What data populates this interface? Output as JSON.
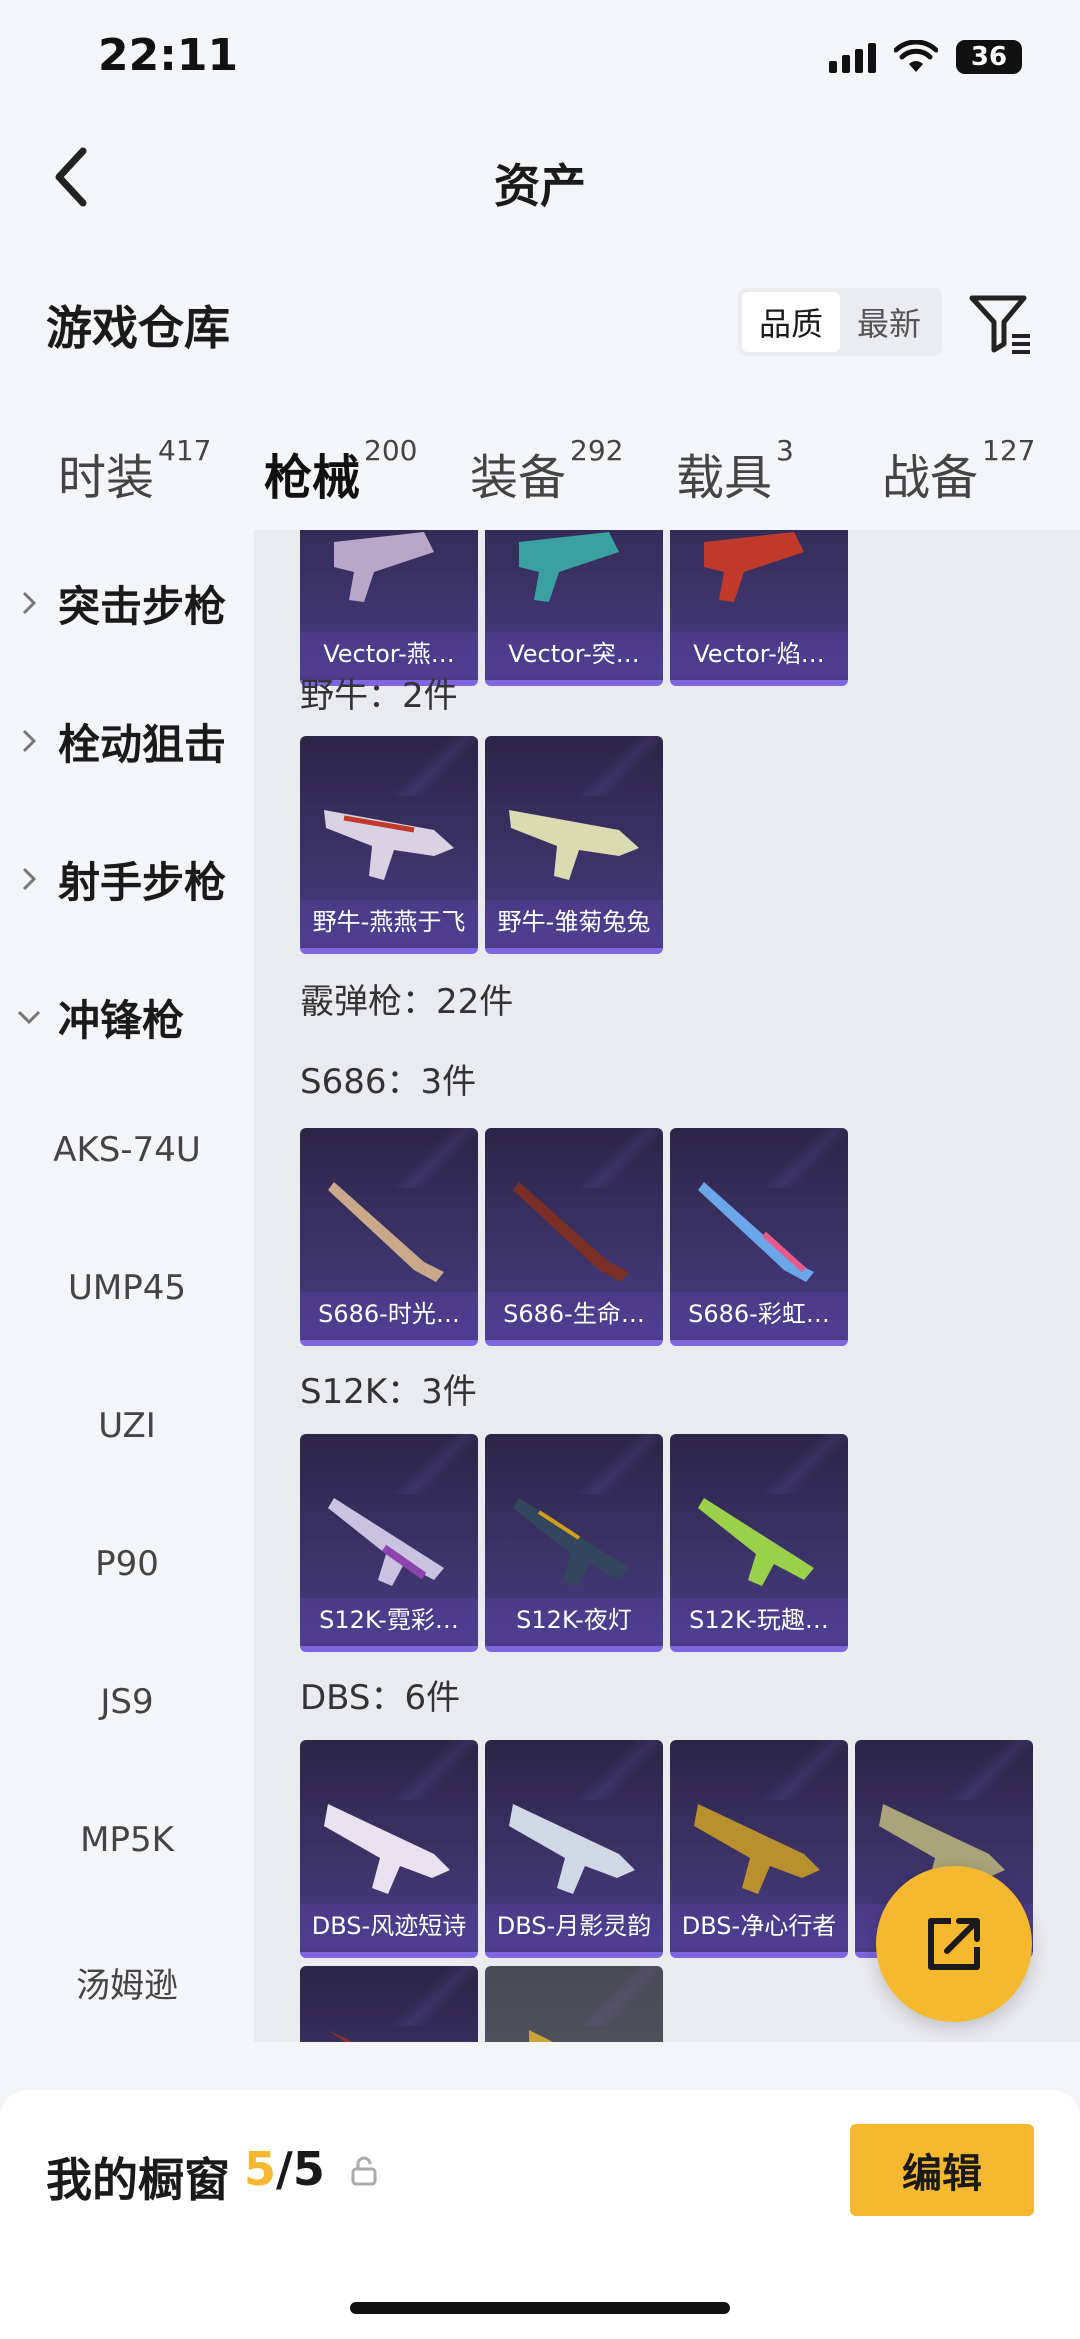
{
  "status_bar": {
    "time": "22:11",
    "battery": "36"
  },
  "header": {
    "title": "资产"
  },
  "section": {
    "title": "游戏仓库",
    "sort_options": [
      "品质",
      "最新"
    ]
  },
  "tabs": [
    {
      "label": "时装",
      "count": "417"
    },
    {
      "label": "枪械",
      "count": "200"
    },
    {
      "label": "装备",
      "count": "292"
    },
    {
      "label": "载具",
      "count": "3"
    },
    {
      "label": "战备",
      "count": "127"
    }
  ],
  "sidebar": {
    "categories": [
      "突击步枪",
      "栓动狙击",
      "射手步枪",
      "冲锋枪"
    ],
    "subitems": [
      "AKS-74U",
      "UMP45",
      "UZI",
      "P90",
      "JS9",
      "MP5K",
      "汤姆逊"
    ]
  },
  "content": {
    "top_row": [
      "Vector-燕…",
      "Vector-突…",
      "Vector-焰…"
    ],
    "groups": [
      {
        "title": "野牛：2件",
        "items": [
          "野牛-燕燕于飞",
          "野牛-雏菊兔兔"
        ]
      },
      {
        "title": "霰弹枪：22件",
        "items": []
      },
      {
        "title": "S686：3件",
        "items": [
          "S686-时光…",
          "S686-生命…",
          "S686-彩虹…"
        ]
      },
      {
        "title": "S12K：3件",
        "items": [
          "S12K-霓彩…",
          "S12K-夜灯",
          "S12K-玩趣…"
        ]
      },
      {
        "title": "DBS：6件",
        "items": [
          "DBS-风迹短诗",
          "DBS-月影灵韵",
          "DBS-净心行者",
          "D"
        ]
      }
    ]
  },
  "bottom_bar": {
    "showcase_label": "我的橱窗",
    "count_current": "5",
    "count_total": "/5",
    "edit_label": "编辑"
  },
  "colors": {
    "accent": "#f5b82e",
    "card_bg": "#3b3266",
    "card_border": "#7d66e0"
  }
}
